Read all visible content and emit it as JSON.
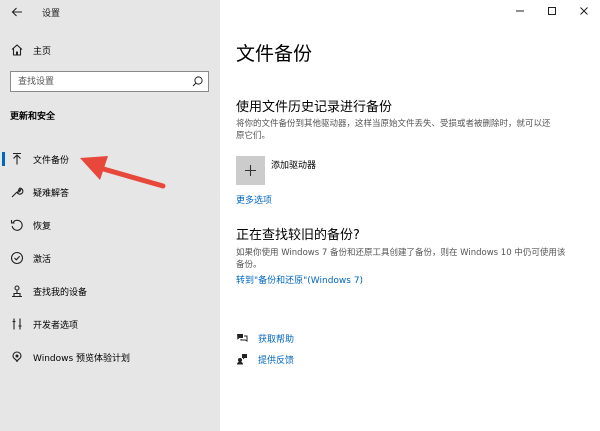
{
  "window": {
    "title": "设置",
    "controls": [
      "minimize-icon",
      "maximize-icon",
      "close-icon"
    ]
  },
  "sidebar": {
    "home_label": "主页",
    "search_placeholder": "查找设置",
    "section_title": "更新和安全",
    "items": [
      {
        "label": "文件备份",
        "icon": "backup-icon",
        "active": true
      },
      {
        "label": "疑难解答",
        "icon": "wrench-icon",
        "active": false
      },
      {
        "label": "恢复",
        "icon": "recovery-icon",
        "active": false
      },
      {
        "label": "激活",
        "icon": "activation-icon",
        "active": false
      },
      {
        "label": "查找我的设备",
        "icon": "find-device-icon",
        "active": false
      },
      {
        "label": "开发者选项",
        "icon": "developer-icon",
        "active": false
      },
      {
        "label": "Windows 预览体验计划",
        "icon": "insider-icon",
        "active": false
      }
    ]
  },
  "main": {
    "page_title": "文件备份",
    "history": {
      "heading": "使用文件历史记录进行备份",
      "description": "将你的文件备份到其他驱动器，这样当原始文件丢失、受损或者被删除时，就可以还原它们。",
      "add_drive_label": "添加驱动器",
      "more_options_link": "更多选项"
    },
    "older": {
      "heading": "正在查找较旧的备份?",
      "description": "如果你使用 Windows 7 备份和还原工具创建了备份，则在 Windows 10 中仍可使用该备份。",
      "link": "转到\"备份和还原\"(Windows 7)"
    },
    "help": {
      "get_help": "获取帮助",
      "feedback": "提供反馈"
    }
  },
  "colors": {
    "accent": "#0067c0",
    "sidebar_bg": "#e6e6e6",
    "annotation_arrow": "#e8473c"
  }
}
